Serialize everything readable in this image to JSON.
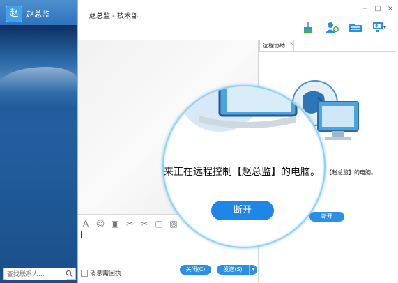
{
  "sidebar": {
    "avatar_char": "赵",
    "user_name": "赵总监",
    "search_placeholder": "查找联系人..."
  },
  "chat": {
    "title": "赵总监 - 技术部",
    "read_receipt_label": "消息需回执",
    "close_button": "关闭(C)",
    "send_button": "发送(S)"
  },
  "window_controls": [
    "−",
    "□",
    "×"
  ],
  "toolbar_icons": [
    "brush-icon",
    "add-contact-icon",
    "folder-icon",
    "remote-screen-icon"
  ],
  "input_tools": [
    "A",
    "☺",
    "▣",
    "✂",
    "✂",
    "▢",
    "▧"
  ],
  "remote_panel": {
    "tab_label": "远程协助",
    "tab_close": "×",
    "status_small": "【赵总监】的电脑。",
    "disconnect_small": "断开"
  },
  "magnifier": {
    "status_text": "来正在远程控制【赵总监】的电脑。",
    "disconnect_button": "断开"
  },
  "colors": {
    "accent": "#2b8fe6",
    "sidebar": "#235fa0"
  }
}
